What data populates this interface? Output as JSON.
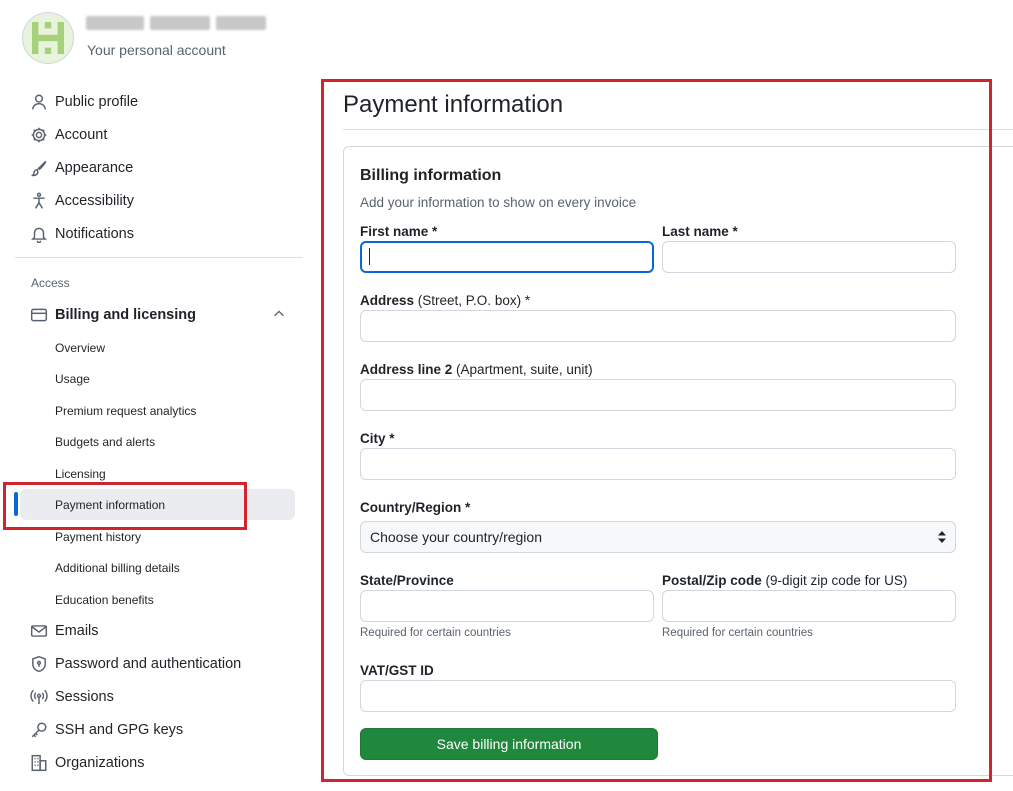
{
  "account": {
    "subtitle": "Your personal account"
  },
  "sidebar": {
    "items_top": [
      {
        "label": "Public profile",
        "icon": "person-icon"
      },
      {
        "label": "Account",
        "icon": "gear-icon"
      },
      {
        "label": "Appearance",
        "icon": "paintbrush-icon"
      },
      {
        "label": "Accessibility",
        "icon": "accessibility-icon"
      },
      {
        "label": "Notifications",
        "icon": "bell-icon"
      }
    ],
    "section_label": "Access",
    "billing": {
      "label": "Billing and licensing",
      "icon": "credit-card-icon",
      "subitems": [
        "Overview",
        "Usage",
        "Premium request analytics",
        "Budgets and alerts",
        "Licensing",
        "Payment information",
        "Payment history",
        "Additional billing details",
        "Education benefits"
      ],
      "active": "Payment information"
    },
    "items_bottom": [
      {
        "label": "Emails",
        "icon": "mail-icon"
      },
      {
        "label": "Password and authentication",
        "icon": "shield-lock-icon"
      },
      {
        "label": "Sessions",
        "icon": "broadcast-icon"
      },
      {
        "label": "SSH and GPG keys",
        "icon": "key-icon"
      },
      {
        "label": "Organizations",
        "icon": "organization-icon"
      }
    ]
  },
  "main": {
    "page_title": "Payment information",
    "card": {
      "heading": "Billing information",
      "description": "Add your information to show on every invoice",
      "fields": {
        "first_name": {
          "label": "First name *",
          "value": ""
        },
        "last_name": {
          "label": "Last name *",
          "value": ""
        },
        "address": {
          "label": "Address",
          "sublabel": " (Street, P.O. box) *",
          "value": ""
        },
        "address2": {
          "label": "Address line 2",
          "sublabel": " (Apartment, suite, unit)",
          "value": ""
        },
        "city": {
          "label": "City *",
          "value": ""
        },
        "country": {
          "label": "Country/Region *",
          "selected": "Choose your country/region"
        },
        "state": {
          "label": "State/Province",
          "value": "",
          "hint": "Required for certain countries"
        },
        "postal": {
          "label": "Postal/Zip code",
          "sublabel": " (9-digit zip code for US)",
          "value": "",
          "hint": "Required for certain countries"
        },
        "vat": {
          "label": "VAT/GST ID",
          "value": ""
        }
      },
      "save_label": "Save billing information"
    }
  },
  "colors": {
    "accent": "#0969da",
    "primary_button": "#1f883d",
    "highlight_box": "#d1242f"
  }
}
